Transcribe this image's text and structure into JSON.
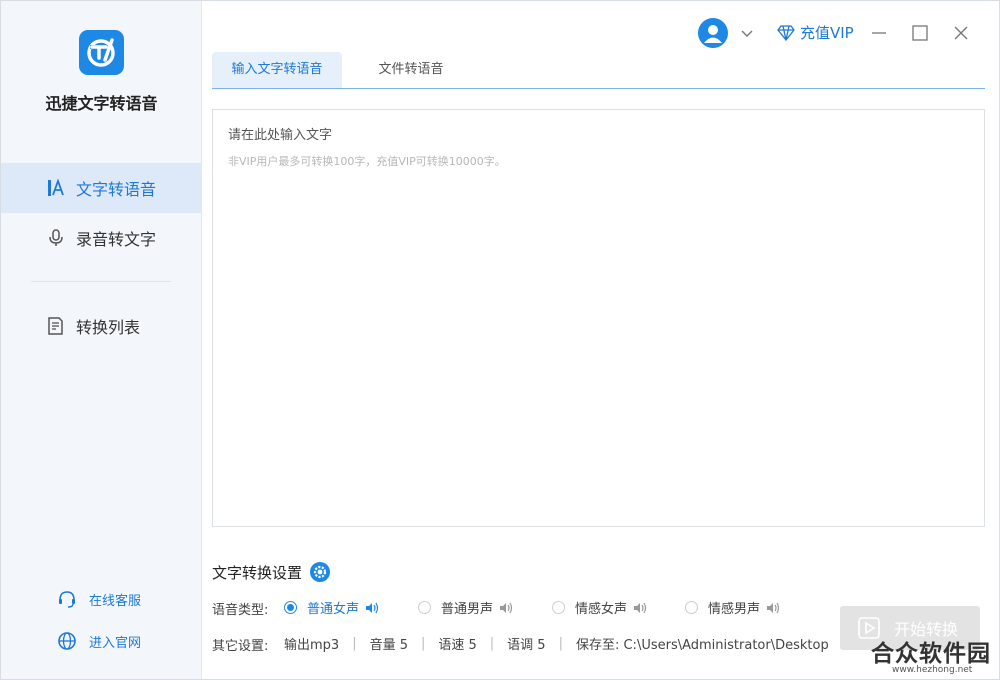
{
  "app": {
    "name": "迅捷文字转语音"
  },
  "sidebar": {
    "items": [
      {
        "label": "文字转语音",
        "icon": "text-a-icon",
        "active": true
      },
      {
        "label": "录音转文字",
        "icon": "microphone-icon",
        "active": false
      },
      {
        "label": "转换列表",
        "icon": "list-doc-icon",
        "active": false
      }
    ],
    "links": [
      {
        "label": "在线客服",
        "icon": "headset-icon"
      },
      {
        "label": "进入官网",
        "icon": "globe-icon"
      }
    ]
  },
  "titlebar": {
    "vip_label": "充值VIP"
  },
  "tabs": [
    {
      "label": "输入文字转语音",
      "active": true
    },
    {
      "label": "文件转语音",
      "active": false
    }
  ],
  "editor": {
    "placeholder": "请在此处输入文字",
    "hint": "非VIP用户最多可转换100字，充值VIP可转换10000字。"
  },
  "settings": {
    "title": "文字转换设置",
    "voice_label": "语音类型:",
    "voices": [
      {
        "label": "普通女声",
        "selected": true
      },
      {
        "label": "普通男声",
        "selected": false
      },
      {
        "label": "情感女声",
        "selected": false
      },
      {
        "label": "情感男声",
        "selected": false
      }
    ],
    "other_label": "其它设置:",
    "output": "输出mp3",
    "volume": "音量 5",
    "speed": "语速 5",
    "pitch": "语调 5",
    "save_to": "保存至: C:\\Users\\Administrator\\Desktop"
  },
  "start_button": "开始转换",
  "watermark": {
    "text": "合众软件园",
    "url": "www.hezhong.net"
  },
  "colors": {
    "accent": "#1e88e5",
    "sidebar_bg": "#f3f7fc",
    "active_item_bg": "#dde9f8"
  }
}
